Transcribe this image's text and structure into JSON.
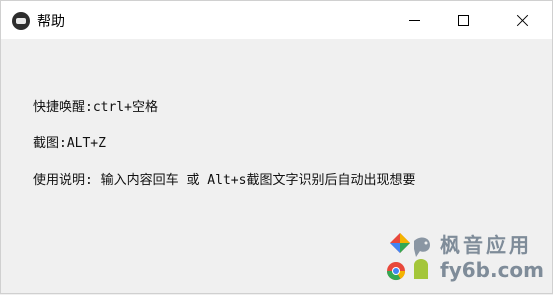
{
  "window": {
    "title": "帮助",
    "controls": {
      "minimize_icon": "minimize-icon",
      "maximize_icon": "maximize-icon",
      "close_icon": "close-icon"
    }
  },
  "content": {
    "line1": "快捷唤醒:ctrl+空格",
    "line2": "截图:ALT+Z",
    "line3": "使用说明: 输入内容回车 或 Alt+s截图文字识别后自动出现想要"
  },
  "watermark": {
    "text_top": "枫音应用",
    "text_bottom": "fy6b.com"
  },
  "colors": {
    "titlebar_bg": "#ffffff",
    "body_bg": "#f0f0f0",
    "watermark_text": "#7f8c99"
  }
}
